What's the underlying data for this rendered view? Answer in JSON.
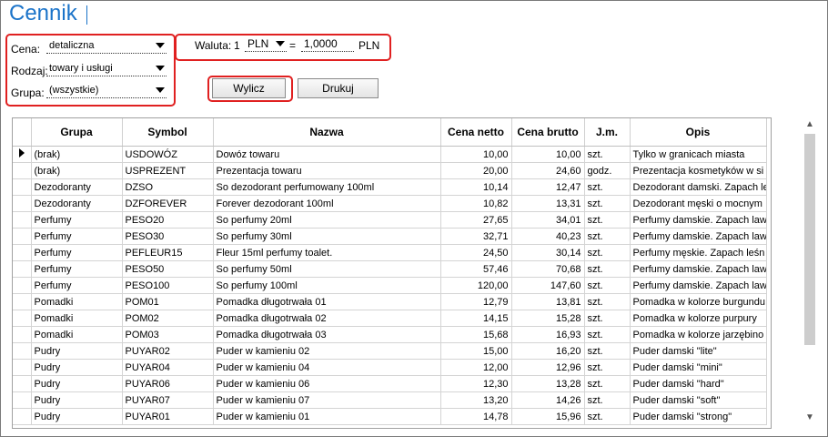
{
  "header": {
    "title": "Cennik"
  },
  "filters": {
    "cena_label": "Cena:",
    "cena_value": "detaliczna",
    "rodzaj_label": "Rodzaj:",
    "rodzaj_value": "towary i usługi",
    "grupa_label": "Grupa:",
    "grupa_value": "(wszystkie)"
  },
  "currency": {
    "label": "Waluta:",
    "amount": "1",
    "currency": "PLN",
    "equals": "=",
    "rate": "1,0000",
    "base": "PLN"
  },
  "buttons": {
    "calculate": "Wylicz",
    "print": "Drukuj"
  },
  "table": {
    "columns": [
      "Grupa",
      "Symbol",
      "Nazwa",
      "Cena netto",
      "Cena brutto",
      "J.m.",
      "Opis"
    ],
    "rows": [
      [
        "(brak)",
        "USDOWÓZ",
        "Dowóz towaru",
        "10,00",
        "10,00",
        "szt.",
        "Tylko w granicach miasta"
      ],
      [
        "(brak)",
        "USPREZENT",
        "Prezentacja towaru",
        "20,00",
        "24,60",
        "godz.",
        "Prezentacja kosmetyków w si"
      ],
      [
        "Dezodoranty",
        "DZSO",
        "So dezodorant perfumowany 100ml",
        "10,14",
        "12,47",
        "szt.",
        "Dezodorant damski. Zapach le"
      ],
      [
        "Dezodoranty",
        "DZFOREVER",
        "Forever dezodorant 100ml",
        "10,82",
        "13,31",
        "szt.",
        "Dezodorant męski o mocnym"
      ],
      [
        "Perfumy",
        "PESO20",
        "So perfumy 20ml",
        "27,65",
        "34,01",
        "szt.",
        "Perfumy damskie. Zapach law"
      ],
      [
        "Perfumy",
        "PESO30",
        "So perfumy 30ml",
        "32,71",
        "40,23",
        "szt.",
        "Perfumy damskie. Zapach law"
      ],
      [
        "Perfumy",
        "PEFLEUR15",
        "Fleur 15ml perfumy toalet.",
        "24,50",
        "30,14",
        "szt.",
        "Perfumy męskie. Zapach leśn"
      ],
      [
        "Perfumy",
        "PESO50",
        "So perfumy 50ml",
        "57,46",
        "70,68",
        "szt.",
        "Perfumy damskie. Zapach law"
      ],
      [
        "Perfumy",
        "PESO100",
        "So perfumy 100ml",
        "120,00",
        "147,60",
        "szt.",
        "Perfumy damskie. Zapach law"
      ],
      [
        "Pomadki",
        "POM01",
        "Pomadka długotrwała 01",
        "12,79",
        "13,81",
        "szt.",
        "Pomadka w kolorze burgundu"
      ],
      [
        "Pomadki",
        "POM02",
        "Pomadka długotrwała 02",
        "14,15",
        "15,28",
        "szt.",
        "Pomadka w kolorze purpury"
      ],
      [
        "Pomadki",
        "POM03",
        "Pomadka długotrwała 03",
        "15,68",
        "16,93",
        "szt.",
        "Pomadka w kolorze jarzębino"
      ],
      [
        "Pudry",
        "PUYAR02",
        "Puder w kamieniu 02",
        "15,00",
        "16,20",
        "szt.",
        "Puder damski \"lite\""
      ],
      [
        "Pudry",
        "PUYAR04",
        "Puder w kamieniu 04",
        "12,00",
        "12,96",
        "szt.",
        "Puder damski \"mini\""
      ],
      [
        "Pudry",
        "PUYAR06",
        "Puder w kamieniu 06",
        "12,30",
        "13,28",
        "szt.",
        "Puder damski \"hard\""
      ],
      [
        "Pudry",
        "PUYAR07",
        "Puder w kamieniu 07",
        "13,20",
        "14,26",
        "szt.",
        "Puder damski \"soft\""
      ],
      [
        "Pudry",
        "PUYAR01",
        "Puder w kamieniu 01",
        "14,78",
        "15,96",
        "szt.",
        "Puder damski \"strong\""
      ]
    ]
  },
  "icons": {
    "row_indicator": "current-row-triangle-icon",
    "scroll_up": "chevron-up-icon",
    "scroll_down": "chevron-down-icon"
  },
  "colors": {
    "title": "#1a73c9",
    "highlight": "#e02020"
  }
}
